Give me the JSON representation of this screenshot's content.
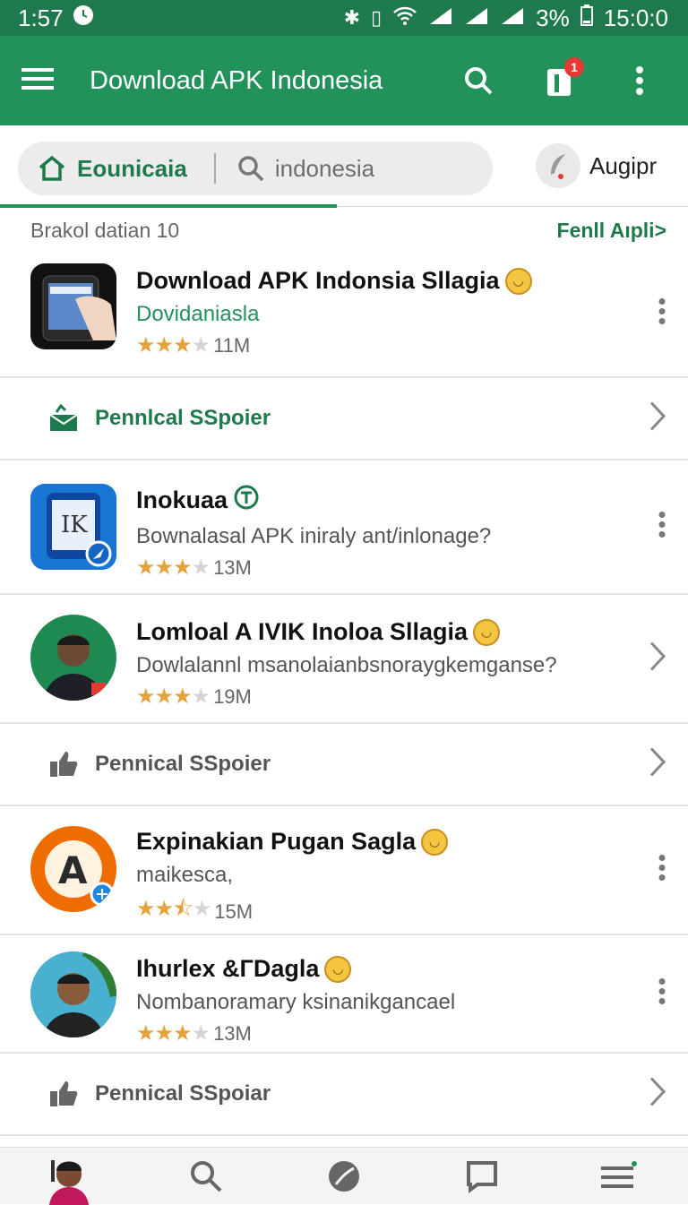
{
  "status_bar": {
    "time": "1:57",
    "battery": "3%",
    "clock_right": "15:0:0"
  },
  "toolbar": {
    "title": "Download APK Indonesia",
    "notification_count": "1"
  },
  "search_row": {
    "home_label": "Eounicaia",
    "search_placeholder": "indonesia",
    "account_label": "Augipr"
  },
  "section": {
    "label": "Brakol datian 10",
    "more_link": "Fenll Aıpli>"
  },
  "apps": [
    {
      "name": "Download APK Indonsia Sllagia",
      "subtitle": "Dovidaniasla",
      "rating": 3,
      "downloads": "11M"
    },
    {
      "name": "Inokuaa",
      "subtitle": "Bownalasal APK iniraly ant/inlonage?",
      "rating": 3,
      "downloads": "13M"
    },
    {
      "name": "Lomloal A IVIK Inoloa Sllagia",
      "subtitle": "Dowlalannl msanolaianbsnoraygkemganse?",
      "rating": 3,
      "downloads": "19M"
    },
    {
      "name": "Expinakian Pugan Sagla",
      "subtitle": "maikesca,",
      "rating": 2.5,
      "downloads": "15M"
    },
    {
      "name": "Ihurlex &ГDagla",
      "subtitle": "Nombanoramary ksinanikgancael",
      "rating": 3,
      "downloads": "13M"
    }
  ],
  "promos": [
    {
      "label": "Pennlcal SSpoier"
    },
    {
      "label": "Pennical SSpoier"
    },
    {
      "label": "Pennical SSpoiar"
    }
  ],
  "colors": {
    "brand_green": "#23915a",
    "status_green": "#1e7a4c",
    "star": "#e6a23c"
  }
}
